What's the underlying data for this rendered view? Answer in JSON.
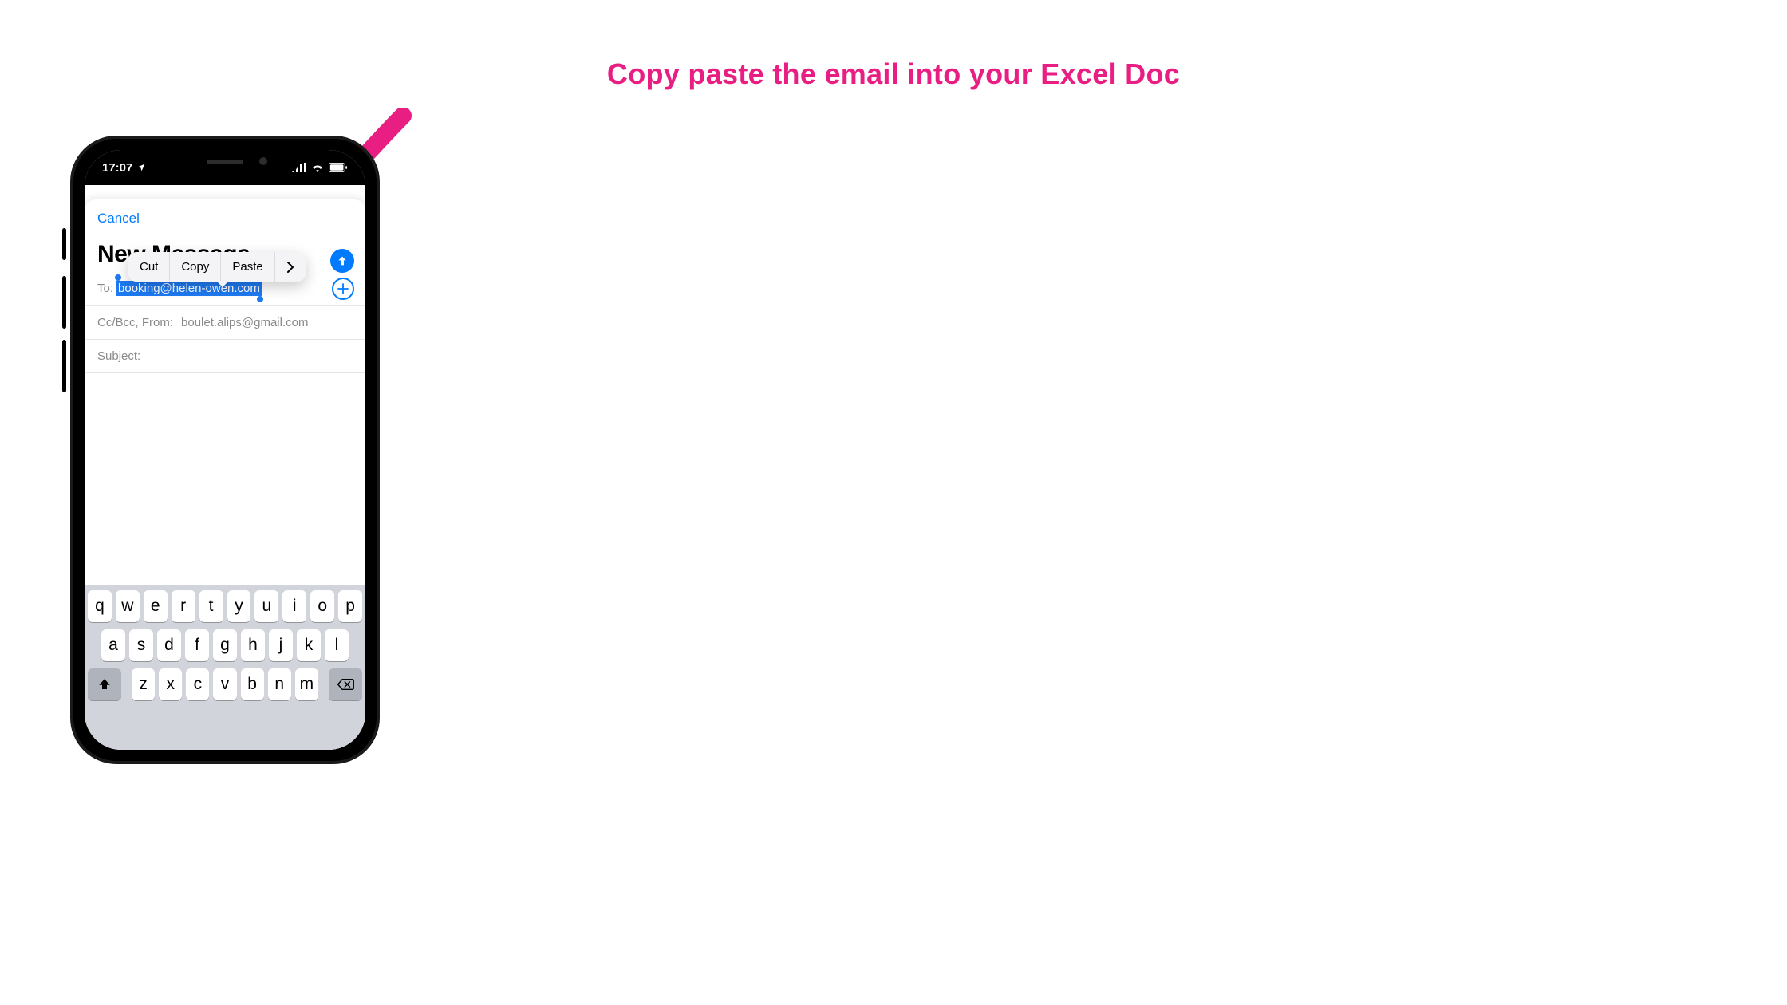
{
  "callout": "Copy paste the email into your Excel Doc",
  "status": {
    "time": "17:07"
  },
  "compose": {
    "cancel": "Cancel",
    "title": "New Message",
    "to_label": "To:",
    "to_value": "booking@helen-owen.com",
    "cc_line_label": "Cc/Bcc, From:",
    "cc_line_value": "boulet.alips@gmail.com",
    "subject_label": "Subject:"
  },
  "context_menu": {
    "cut": "Cut",
    "copy": "Copy",
    "paste": "Paste"
  },
  "keyboard": {
    "row1": [
      "q",
      "w",
      "e",
      "r",
      "t",
      "y",
      "u",
      "i",
      "o",
      "p"
    ],
    "row2": [
      "a",
      "s",
      "d",
      "f",
      "g",
      "h",
      "j",
      "k",
      "l"
    ],
    "row3": [
      "z",
      "x",
      "c",
      "v",
      "b",
      "n",
      "m"
    ]
  },
  "colors": {
    "accent": "#e91e82",
    "ios_blue": "#007aff"
  }
}
